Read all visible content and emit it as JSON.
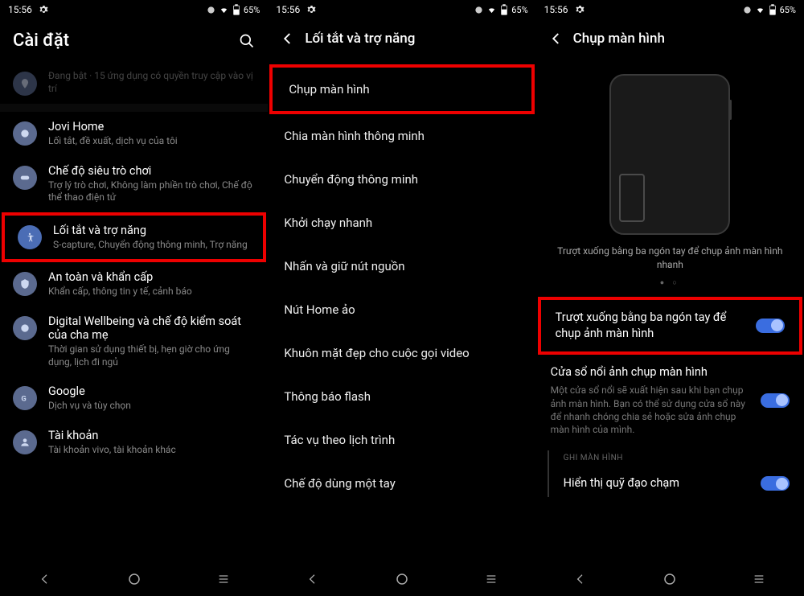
{
  "statusbar": {
    "time": "15:56",
    "battery": "65%"
  },
  "screen1": {
    "title": "Cài đặt",
    "items": [
      {
        "title": "Đang bật · 15 ứng dụng có quyền truy cập vào vị trí",
        "subtitle": ""
      },
      {
        "title": "Jovi Home",
        "subtitle": "Lối tắt, đề xuất, dịch vụ của tôi"
      },
      {
        "title": "Chế độ siêu trò chơi",
        "subtitle": "Trợ lý trò chơi, Không làm phiền trò chơi, Chế độ thể thao điện tử"
      },
      {
        "title": "Lối tắt và trợ năng",
        "subtitle": "S-capture, Chuyển động thông minh, Trợ năng"
      },
      {
        "title": "An toàn và khẩn cấp",
        "subtitle": "Khẩn cấp, thông tin y tế, cảnh báo"
      },
      {
        "title": "Digital Wellbeing và chế độ kiểm soát của cha mẹ",
        "subtitle": "Thời gian sử dụng thiết bị, hẹn giờ cho ứng dụng, lịch đi ngủ"
      },
      {
        "title": "Google",
        "subtitle": "Dịch vụ và tùy chọn"
      },
      {
        "title": "Tài khoản",
        "subtitle": "Tài khoản vivo, tài khoản khác"
      }
    ]
  },
  "screen2": {
    "title": "Lối tắt và trợ năng",
    "items": [
      "Chụp màn hình",
      "Chia màn hình thông minh",
      "Chuyển động thông minh",
      "Khởi chạy nhanh",
      "Nhấn và giữ nút nguồn",
      "Nút Home ảo",
      "Khuôn mặt đẹp cho cuộc gọi video",
      "Thông báo flash",
      "Tác vụ theo lịch trình",
      "Chế độ dùng một tay"
    ]
  },
  "screen3": {
    "title": "Chụp màn hình",
    "caption": "Trượt xuống bằng ba ngón tay để chụp ảnh màn hình nhanh",
    "toggles": [
      {
        "title": "Trượt xuống bằng ba ngón tay để chụp ảnh màn hình",
        "subtitle": ""
      },
      {
        "title": "Cửa sổ nổi ảnh chụp màn hình",
        "subtitle": "Một cửa sổ nổi sẽ xuất hiện sau khi bạn chụp ảnh màn hình. Bạn có thể sử dụng cửa sổ này để nhanh chóng chia sẻ hoặc sửa ảnh chụp màn hình của mình."
      }
    ],
    "section_label": "GHI MÀN HÌNH",
    "record_item": "Hiển thị quỹ đạo chạm"
  }
}
